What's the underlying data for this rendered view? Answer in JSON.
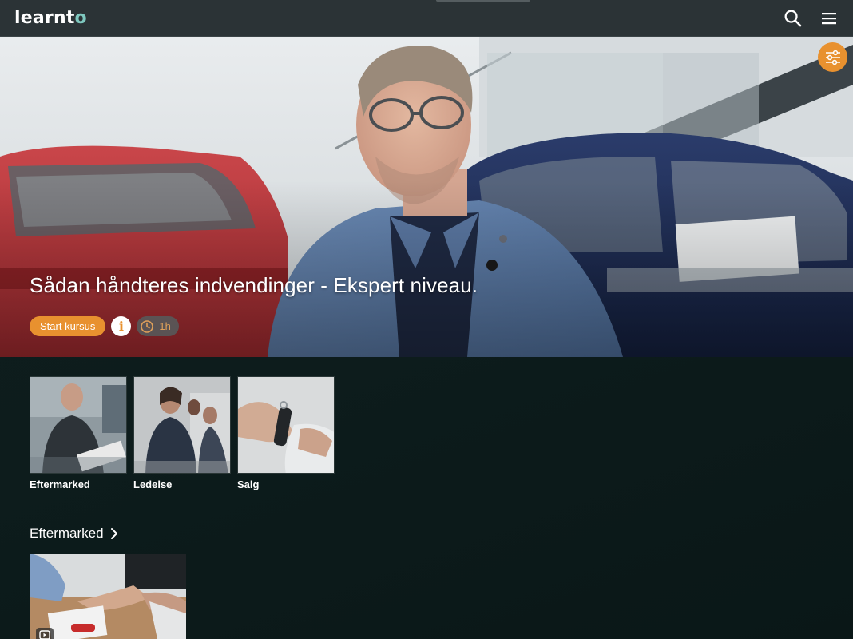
{
  "header": {
    "logo_text_main": "learnt",
    "logo_text_accent": "o",
    "search_icon": "search-icon",
    "menu_icon": "hamburger-menu-icon"
  },
  "hero": {
    "title": "Sådan håndteres indvendinger - Ekspert niveau.",
    "start_label": "Start kursus",
    "info_label": "i",
    "duration": "1h",
    "filter_icon": "sliders-icon",
    "colors": {
      "accent": "#e8912f",
      "duration_text": "#e0a05a"
    }
  },
  "categories": [
    {
      "label": "Eftermarked"
    },
    {
      "label": "Ledelse"
    },
    {
      "label": "Salg"
    }
  ],
  "section": {
    "title": "Eftermarked",
    "chevron_icon": "chevron-right-icon",
    "course_badge_icon": "video-icon"
  },
  "colors": {
    "header_bg": "#2b3336",
    "page_bg": "#0f1f1f",
    "logo_accent": "#7ec8bf"
  }
}
